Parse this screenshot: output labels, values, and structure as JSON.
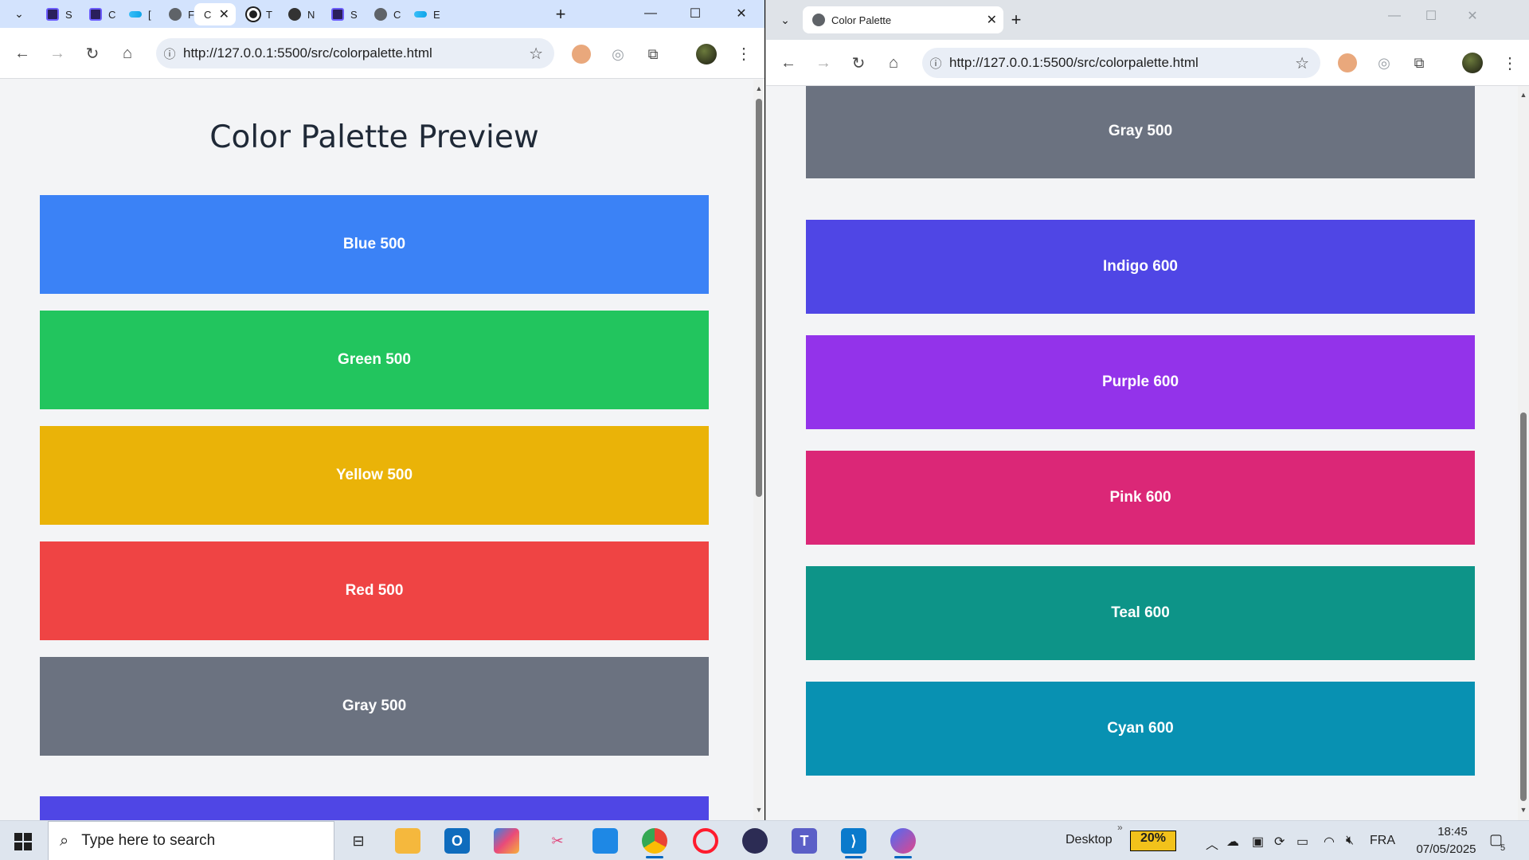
{
  "left_window": {
    "tabs": [
      {
        "icon": "ui-icon",
        "label": "S"
      },
      {
        "icon": "ui-icon",
        "label": "C"
      },
      {
        "icon": "tailwind-icon",
        "label": "[",
        "active": false
      },
      {
        "icon": "globe-icon",
        "label": "F"
      },
      {
        "icon": "globe-icon",
        "label": "C",
        "active": true
      },
      {
        "icon": "openai-icon",
        "label": "T"
      },
      {
        "icon": "github-icon",
        "label": "N"
      },
      {
        "icon": "ui-icon",
        "label": "S"
      },
      {
        "icon": "globe-icon",
        "label": "C"
      },
      {
        "icon": "tailwind-icon",
        "label": "E"
      }
    ],
    "url": "http://127.0.0.1:5500/src/colorpalette.html",
    "page_title": "Color Palette Preview",
    "swatches": [
      {
        "label": "Blue 500",
        "color": "#3b82f6"
      },
      {
        "label": "Green 500",
        "color": "#22c55e"
      },
      {
        "label": "Yellow 500",
        "color": "#eab308"
      },
      {
        "label": "Red 500",
        "color": "#ef4444"
      },
      {
        "label": "Gray 500",
        "color": "#6b7280"
      },
      {
        "label": "",
        "color": "#4f46e5"
      }
    ]
  },
  "right_window": {
    "tab_title": "Color Palette",
    "url": "http://127.0.0.1:5500/src/colorpalette.html",
    "swatches": [
      {
        "label": "Gray 500",
        "color": "#6b7280"
      },
      {
        "label": "Indigo 600",
        "color": "#4f46e5"
      },
      {
        "label": "Purple 600",
        "color": "#9333ea"
      },
      {
        "label": "Pink 600",
        "color": "#db2777"
      },
      {
        "label": "Teal 600",
        "color": "#0d9488"
      },
      {
        "label": "Cyan 600",
        "color": "#0891b2"
      }
    ]
  },
  "taskbar": {
    "search_placeholder": "Type here to search",
    "desktop_label": "Desktop",
    "battery_percent": "20%",
    "language": "FRA",
    "time": "18:45",
    "date": "07/05/2025",
    "notification_count": "5"
  }
}
